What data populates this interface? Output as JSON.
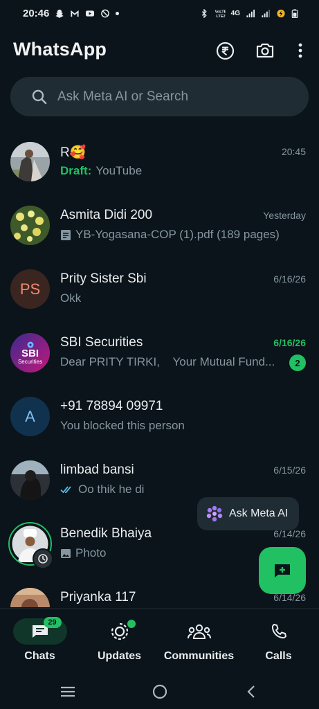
{
  "status_bar": {
    "time": "20:46",
    "network": "4G"
  },
  "header": {
    "title": "WhatsApp"
  },
  "search": {
    "placeholder": "Ask Meta AI or Search"
  },
  "chats": [
    {
      "name": "R🥰",
      "time": "20:45",
      "draft_label": "Draft:",
      "preview": "YouTube"
    },
    {
      "name": "Asmita Didi 200",
      "time": "Yesterday",
      "preview": "YB-Yogasana-COP (1).pdf (189 pages)"
    },
    {
      "name": "Prity Sister Sbi",
      "time": "6/16/26",
      "preview": "Okk",
      "initials": "PS"
    },
    {
      "name": "SBI Securities",
      "time": "6/16/26",
      "preview": "Dear PRITY TIRKI,    Your Mutual Fund...",
      "unread": "2",
      "logo_line1": "SBI",
      "logo_line2": "Securities"
    },
    {
      "name": "+91 78894 09971",
      "time": "",
      "preview": "You blocked this person",
      "initials": "A"
    },
    {
      "name": "limbad bansi",
      "time": "6/15/26",
      "preview": "Oo thik he di"
    },
    {
      "name": "Benedik Bhaiya",
      "time": "6/14/26",
      "preview": "Photo"
    },
    {
      "name": "Priyanka 117",
      "time": "6/14/26",
      "preview": ""
    }
  ],
  "meta_ai": {
    "label": "Ask Meta AI"
  },
  "bottom_nav": {
    "chats": {
      "label": "Chats",
      "badge": "29"
    },
    "updates": {
      "label": "Updates"
    },
    "communities": {
      "label": "Communities"
    },
    "calls": {
      "label": "Calls"
    }
  },
  "colors": {
    "background": "#0b141a",
    "accent": "#21c063",
    "surface": "#202c33",
    "muted_text": "#8696a0"
  }
}
